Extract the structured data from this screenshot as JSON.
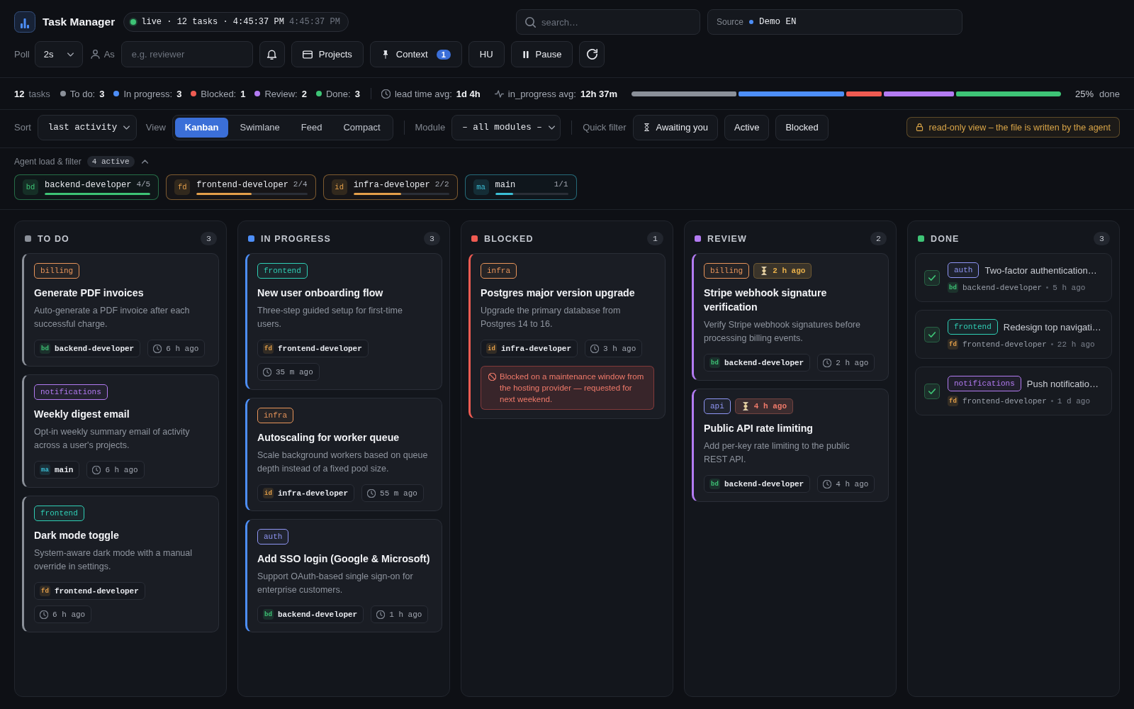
{
  "header": {
    "title": "Task Manager",
    "live": {
      "status": "live · 12 tasks · 4:45:37 PM",
      "time": "4:45:37 PM"
    },
    "search": {
      "placeholder": "search…"
    },
    "source": {
      "label": "Source",
      "value": "Demo EN"
    }
  },
  "toolbar": {
    "poll": {
      "label": "Poll",
      "value": "2s"
    },
    "as": {
      "label": "As",
      "placeholder": "e.g. reviewer"
    },
    "projects": "Projects",
    "context": {
      "label": "Context",
      "badge": "1"
    },
    "language": "HU",
    "pause": "Pause"
  },
  "stats": {
    "total": "12",
    "total_label": "tasks",
    "statuses": [
      {
        "label": "To do:",
        "value": "3",
        "color": "#8b9099"
      },
      {
        "label": "In progress:",
        "value": "3",
        "color": "#4d8ef7"
      },
      {
        "label": "Blocked:",
        "value": "1",
        "color": "#ef5b52"
      },
      {
        "label": "Review:",
        "value": "2",
        "color": "#b37bf2"
      },
      {
        "label": "Done:",
        "value": "3",
        "color": "#3ec476"
      }
    ],
    "lead_time": {
      "label": "lead time avg:",
      "value": "1d 4h"
    },
    "in_progress_avg": {
      "label": "in_progress avg:",
      "value": "12h 37m"
    },
    "progress": {
      "percent": "25%",
      "label": "done"
    }
  },
  "controls": {
    "sort": {
      "label": "Sort",
      "value": "last activity"
    },
    "view": {
      "label": "View",
      "options": [
        {
          "label": "Kanban",
          "selected": true
        },
        {
          "label": "Swimlane",
          "selected": false
        },
        {
          "label": "Feed",
          "selected": false
        },
        {
          "label": "Compact",
          "selected": false
        }
      ]
    },
    "module": {
      "label": "Module",
      "value": "– all modules –"
    },
    "quick_filter": {
      "label": "Quick filter",
      "options": [
        {
          "label": "Awaiting you",
          "kind": "awaiting",
          "selected": false
        },
        {
          "label": "Active",
          "kind": "plain",
          "selected": false
        },
        {
          "label": "Blocked",
          "kind": "plain",
          "selected": false
        }
      ]
    },
    "notice": "read-only view – the file is written by the agent"
  },
  "agents": {
    "label": "Agent load & filter",
    "active": "4 active",
    "expanded": true,
    "items": [
      {
        "initials": "bd",
        "name": "backend-developer",
        "load": "4/5",
        "level": 1,
        "color": "#3ec476",
        "selected": true
      },
      {
        "initials": "fd",
        "name": "frontend-developer",
        "load": "2/4",
        "level": 0.5,
        "color": "#e5a04a",
        "selected": true
      },
      {
        "initials": "id",
        "name": "infra-developer",
        "load": "2/2",
        "level": 0.5,
        "color": "#e5a04a",
        "selected": true
      },
      {
        "initials": "ma",
        "name": "main",
        "load": "1/1",
        "level": 0.25,
        "color": "#3bbfd6",
        "selected": true
      }
    ]
  },
  "columns": [
    {
      "title": "TO DO",
      "count": "3",
      "color": "#8b9099",
      "kind": "board",
      "cards": [
        {
          "tag": {
            "label": "billing",
            "color": "#e8955a"
          },
          "title": "Generate PDF invoices",
          "description": "Auto-generate a PDF invoice after each successful charge.",
          "agent": {
            "initials": "bd",
            "name": "backend-developer",
            "color": "#3ec476"
          },
          "time": "6 h ago"
        },
        {
          "tag": {
            "label": "notifications",
            "color": "#b37bf2"
          },
          "title": "Weekly digest email",
          "description": "Opt-in weekly summary email of activity across a user's projects.",
          "agent": {
            "initials": "ma",
            "name": "main",
            "color": "#3bbfd6"
          },
          "time": "6 h ago"
        },
        {
          "tag": {
            "label": "frontend",
            "color": "#2fcfb5"
          },
          "title": "Dark mode toggle",
          "description": "System-aware dark mode with a manual override in settings.",
          "agent": {
            "initials": "fd",
            "name": "frontend-developer",
            "color": "#e5a04a"
          },
          "time": "6 h ago"
        }
      ]
    },
    {
      "title": "IN PROGRESS",
      "count": "3",
      "color": "#4d8ef7",
      "kind": "board",
      "cards": [
        {
          "tag": {
            "label": "frontend",
            "color": "#2fcfb5"
          },
          "title": "New user onboarding flow",
          "description": "Three-step guided setup for first-time users.",
          "agent": {
            "initials": "fd",
            "name": "frontend-developer",
            "color": "#e5a04a"
          },
          "time": "35 m ago"
        },
        {
          "tag": {
            "label": "infra",
            "color": "#e8955a"
          },
          "title": "Autoscaling for worker queue",
          "description": "Scale background workers based on queue depth instead of a fixed pool size.",
          "agent": {
            "initials": "id",
            "name": "infra-developer",
            "color": "#e5a04a"
          },
          "time": "55 m ago"
        },
        {
          "tag": {
            "label": "auth",
            "color": "#8f96f5"
          },
          "title": "Add SSO login (Google & Microsoft)",
          "description": "Support OAuth-based single sign-on for enterprise customers.",
          "agent": {
            "initials": "bd",
            "name": "backend-developer",
            "color": "#3ec476"
          },
          "time": "1 h ago"
        }
      ]
    },
    {
      "title": "BLOCKED",
      "count": "1",
      "color": "#ef5b52",
      "kind": "board",
      "cards": [
        {
          "tag": {
            "label": "infra",
            "color": "#e8955a"
          },
          "title": "Postgres major version upgrade",
          "description": "Upgrade the primary database from Postgres 14 to 16.",
          "agent": {
            "initials": "id",
            "name": "infra-developer",
            "color": "#e5a04a"
          },
          "time": "3 h ago",
          "blocked_note": "Blocked on a maintenance window from the hosting provider — requested for next weekend."
        }
      ]
    },
    {
      "title": "REVIEW",
      "count": "2",
      "color": "#b37bf2",
      "kind": "board",
      "cards": [
        {
          "tag": {
            "label": "billing",
            "color": "#e8955a"
          },
          "waiting": {
            "text": "2 h ago",
            "color": "#e8b04a"
          },
          "title": "Stripe webhook signature verification",
          "description": "Verify Stripe webhook signatures before processing billing events.",
          "agent": {
            "initials": "bd",
            "name": "backend-developer",
            "color": "#3ec476"
          },
          "time": "2 h ago"
        },
        {
          "tag": {
            "label": "api",
            "color": "#8f96f5"
          },
          "waiting": {
            "text": "4 h ago",
            "color": "#f07a6a"
          },
          "title": "Public API rate limiting",
          "description": "Add per-key rate limiting to the public REST API.",
          "agent": {
            "initials": "bd",
            "name": "backend-developer",
            "color": "#3ec476"
          },
          "time": "4 h ago"
        }
      ]
    },
    {
      "title": "DONE",
      "count": "3",
      "color": "#3ec476",
      "kind": "done",
      "cards": [
        {
          "checked": true,
          "tag": {
            "label": "auth",
            "color": "#8f96f5"
          },
          "title": "Two-factor authentication…",
          "agent": {
            "initials": "bd",
            "name": "backend-developer",
            "color": "#3ec476"
          },
          "time": "5 h ago"
        },
        {
          "checked": true,
          "tag": {
            "label": "frontend",
            "color": "#2fcfb5"
          },
          "title": "Redesign top navigati…",
          "agent": {
            "initials": "fd",
            "name": "frontend-developer",
            "color": "#e5a04a"
          },
          "time": "22 h ago"
        },
        {
          "checked": true,
          "tag": {
            "label": "notifications",
            "color": "#b37bf2"
          },
          "title": "Push notificatio…",
          "agent": {
            "initials": "fd",
            "name": "frontend-developer",
            "color": "#e5a04a"
          },
          "time": "1 d ago"
        }
      ]
    }
  ]
}
